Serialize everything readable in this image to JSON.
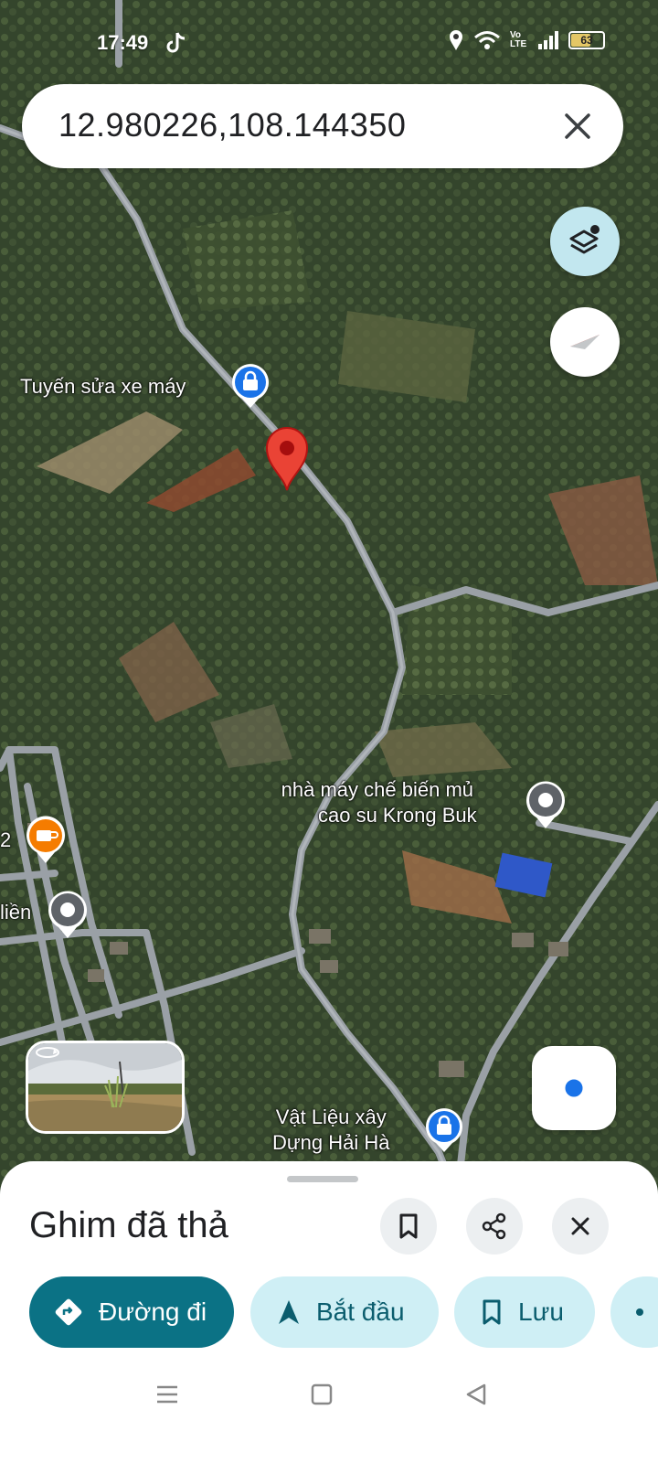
{
  "status_bar": {
    "time": "17:49",
    "network": "Vo LTE",
    "battery": "63",
    "battery_level": 0.63,
    "icons": [
      "tiktok-icon",
      "location-icon",
      "wifi-icon",
      "signal-icon",
      "battery-icon"
    ]
  },
  "search": {
    "value": "12.980226,108.144350",
    "close_icon": "close-icon"
  },
  "map": {
    "labels": {
      "poi1": "Tuyến sửa xe máy",
      "poi2_line1": "nhà máy chế biến mủ",
      "poi2_line2": "cao su Krong Buk",
      "poi3_line1": "Vật Liệu xây",
      "poi3_line2": "Dựng Hải Hà",
      "poi4": "2",
      "poi5": "liền"
    },
    "colors": {
      "road": "#9aa0a6",
      "pin": "#ea4335",
      "shop_marker": "#1a73e8",
      "cafe_marker": "#f57c00",
      "gray_marker": "#5f6368"
    }
  },
  "sheet": {
    "title": "Ghim đã thả",
    "actions": {
      "directions": "Đường đi",
      "start": "Bắt đầu",
      "save": "Lưu"
    },
    "accent": "#0b7285"
  }
}
